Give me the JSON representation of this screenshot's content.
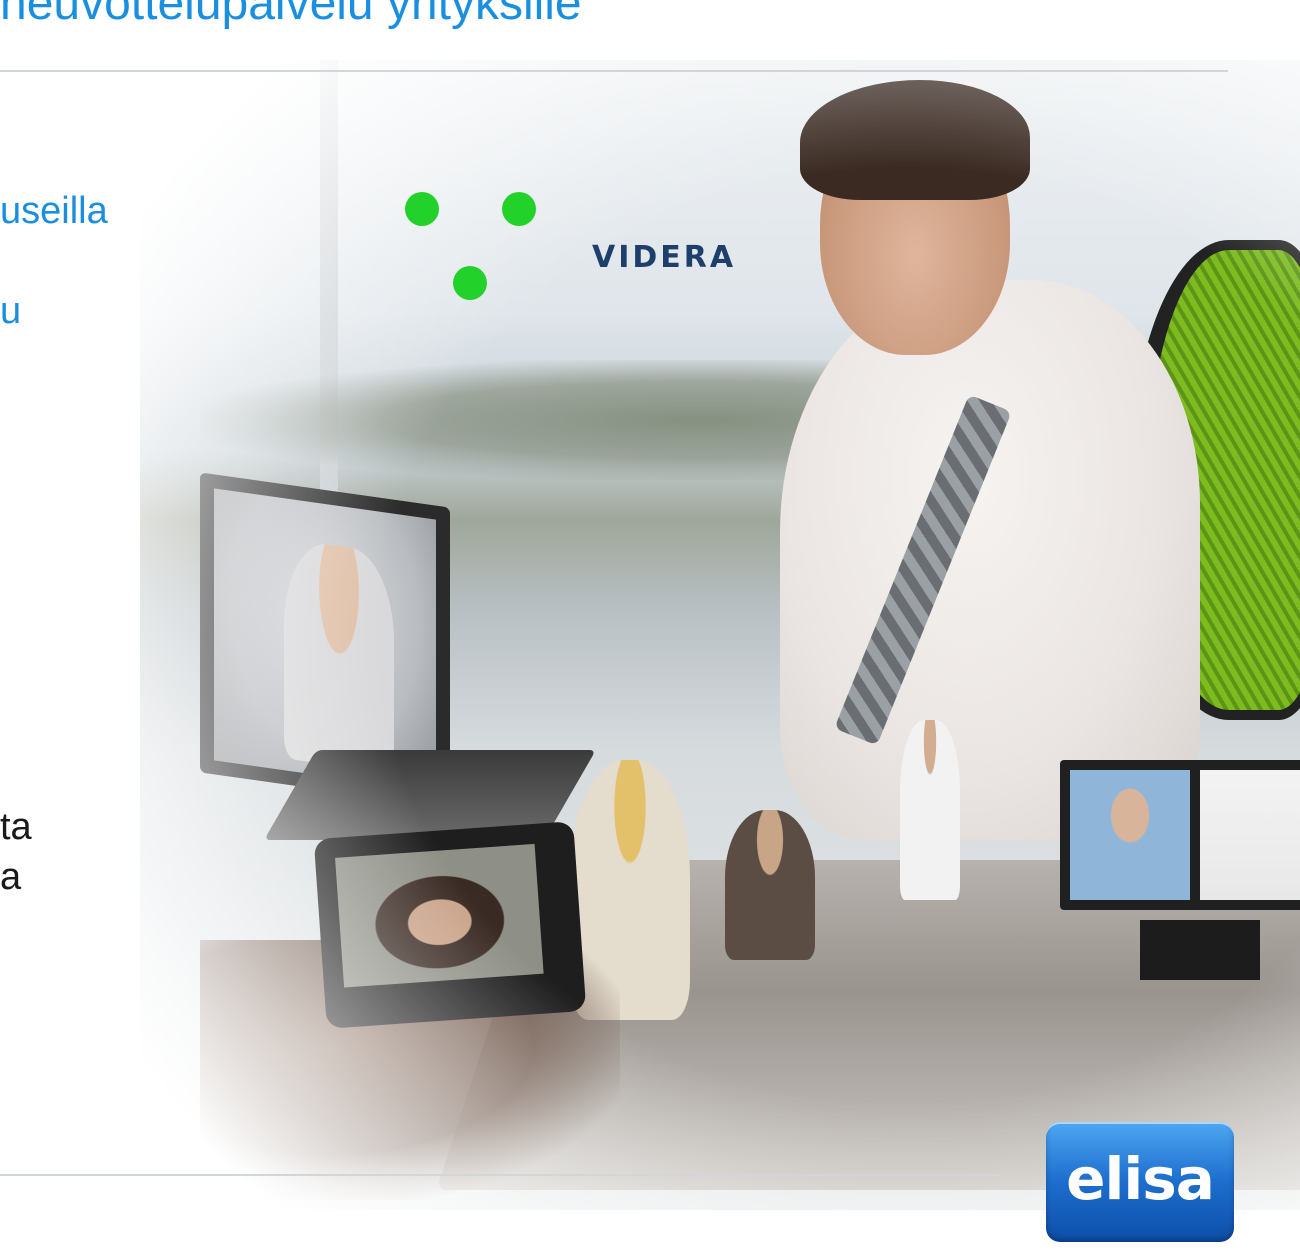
{
  "slide": {
    "title": "neuvottelupalvelu yrityksille",
    "fragments": {
      "line_useilla": "useilla",
      "line_u": "u",
      "line_ta": "ta",
      "line_a": "a"
    }
  },
  "logos": {
    "videra": {
      "wordmark": "VIDERA",
      "dot_color": "#22d22a",
      "text_color": "#1e3f6b"
    },
    "elisa": {
      "wordmark": "elisa",
      "bg_color": "#1e6fcf"
    }
  },
  "colors": {
    "title_blue": "#1a8fe0",
    "rule_gray": "#d3d6d9"
  },
  "photo": {
    "description_icon": "videoconference-collage-image"
  }
}
